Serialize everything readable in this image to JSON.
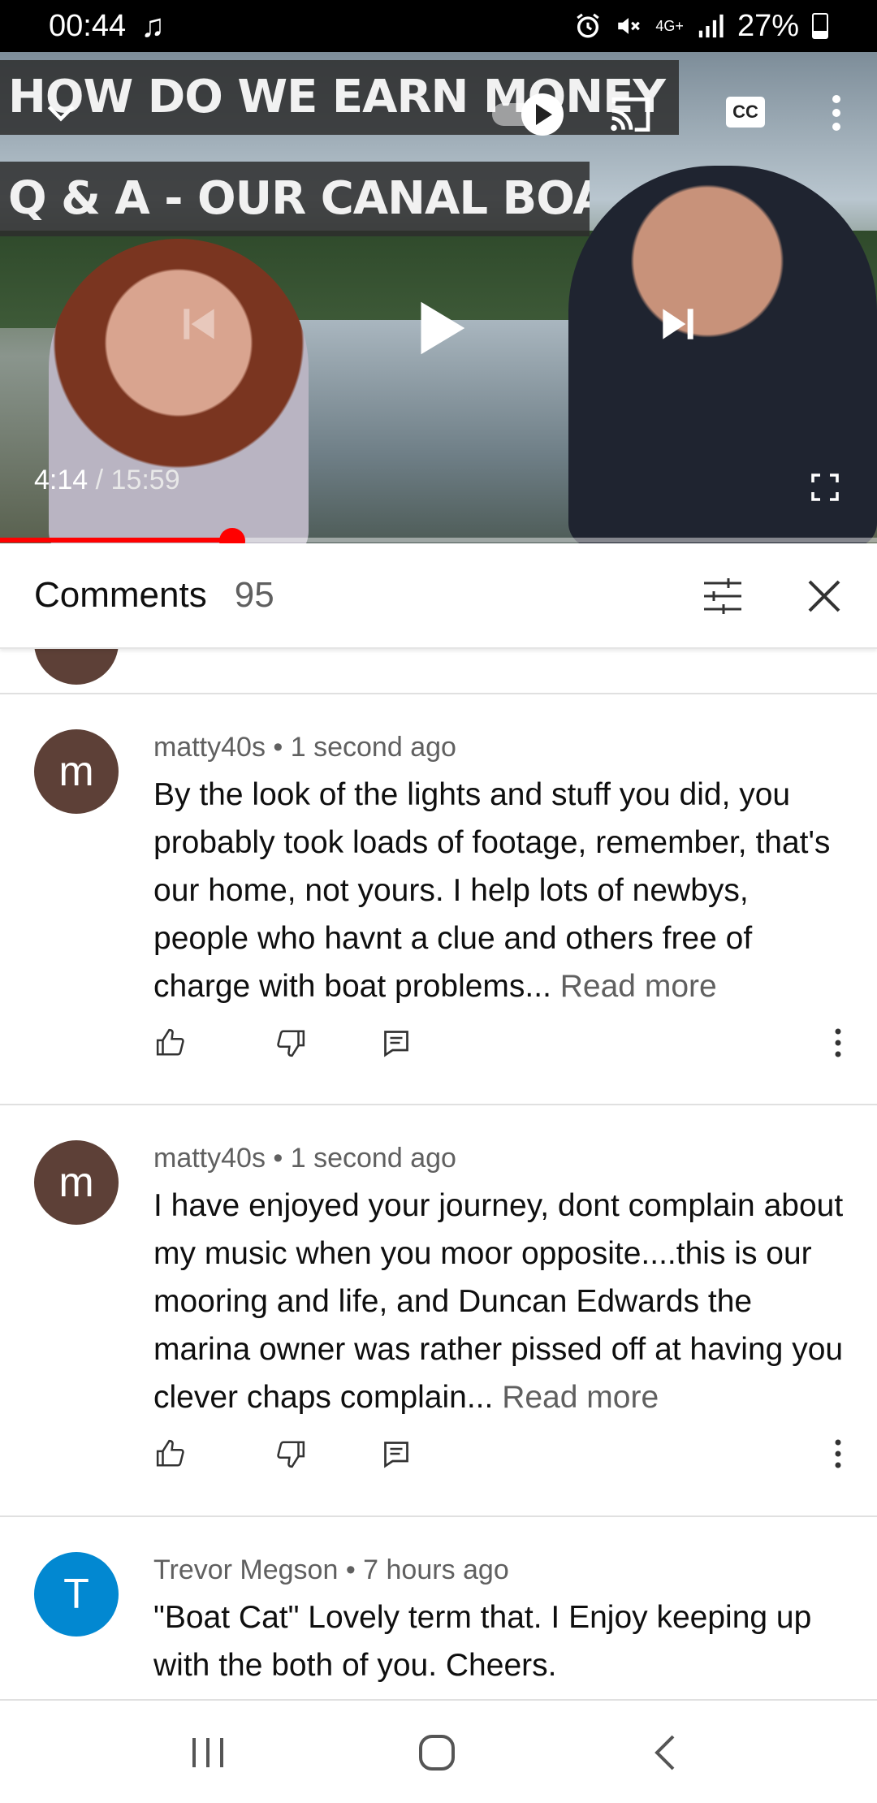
{
  "status_bar": {
    "time": "00:44",
    "music_icon": "music-note-icon",
    "network": "4G+",
    "battery": "27%",
    "battery_level": 0.27
  },
  "video": {
    "title_line_1": "HOW DO WE EARN MONEY ONBOARD?",
    "title_line_2": "Q & A - OUR CANAL BOAT LIFE",
    "current_time": "4:14",
    "separator": " / ",
    "duration": "15:59",
    "progress": 0.265,
    "cc_label": "CC",
    "icons": [
      "chevron-down-icon",
      "autoplay-toggle-icon",
      "cast-icon",
      "captions-icon",
      "more-vert-icon",
      "previous-icon",
      "play-icon",
      "next-icon",
      "fullscreen-icon"
    ]
  },
  "comments_header": {
    "title": "Comments",
    "count": "95",
    "icons": [
      "sort-filter-icon",
      "close-icon"
    ]
  },
  "comments": [
    {
      "author": "matty40s",
      "time": "1 second ago",
      "avatar_letter": "m",
      "avatar_color": "#5d4037",
      "text": "By the look of the lights and stuff you did, you probably took loads of footage, remember, that's our home, not yours. I help lots of newbys, people who havnt a clue and others free of charge with boat problems...",
      "read_more": "Read more"
    },
    {
      "author": "matty40s",
      "time": "1 second ago",
      "avatar_letter": "m",
      "avatar_color": "#5d4037",
      "text": "I have enjoyed your journey, dont complain about my music when you moor opposite....this is our mooring and life, and Duncan Edwards the marina owner was rather pissed off at having you clever chaps complain...",
      "read_more": "Read more"
    },
    {
      "author": "Trevor Megson",
      "time": "7 hours ago",
      "avatar_letter": "T",
      "avatar_color": "#0288d1",
      "text": "\"Boat Cat\"  Lovely term that. I Enjoy keeping up with the both of you. Cheers.",
      "read_more": ""
    }
  ],
  "comment_actions": [
    "like-icon",
    "dislike-icon",
    "reply-icon",
    "more-vert-icon"
  ],
  "meta_separator": " • ",
  "nav_bar": [
    "recent-apps-icon",
    "home-icon",
    "back-icon"
  ]
}
